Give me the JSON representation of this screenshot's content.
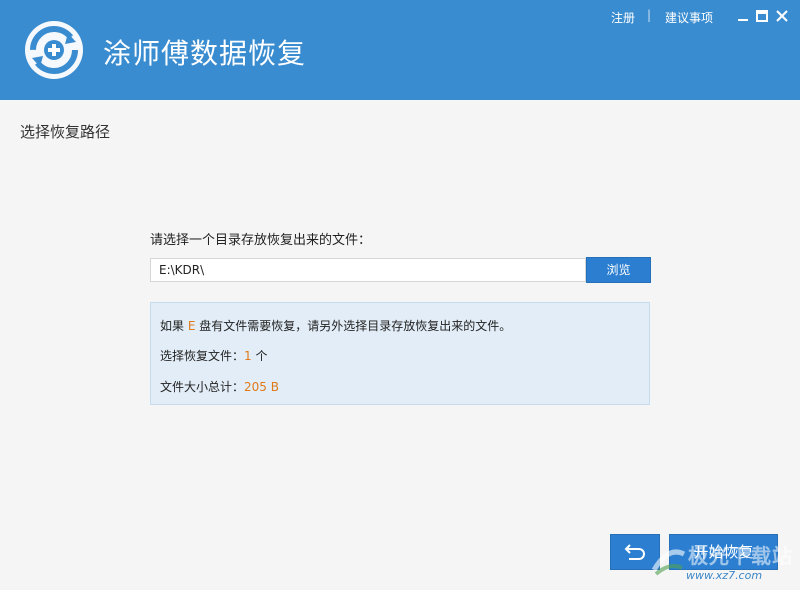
{
  "app": {
    "title": "涂师傅数据恢复",
    "register_link": "注册",
    "separator": "|",
    "suggestion_link": "建议事项"
  },
  "page": {
    "section_title": "选择恢复路径",
    "prompt": "请选择一个目录存放恢复出来的文件：",
    "path_value": "E:\\KDR\\",
    "browse_label": "浏览"
  },
  "info": {
    "line1_prefix": "如果 ",
    "drive": "E",
    "line1_suffix": " 盘有文件需要恢复，请另外选择目录存放恢复出来的文件。",
    "selected_label": "选择恢复文件：",
    "selected_count": "1",
    "selected_unit": " 个",
    "size_label": "文件大小总计：",
    "size_value": "205 B"
  },
  "footer": {
    "start_label": "开始恢复"
  },
  "watermark": {
    "text": "极光下载站",
    "url": "www.xz7.com"
  },
  "colors": {
    "header": "#3a8cd0",
    "button": "#2c7fd0",
    "highlight": "#e07a1a",
    "info_bg": "#e2edf7"
  }
}
